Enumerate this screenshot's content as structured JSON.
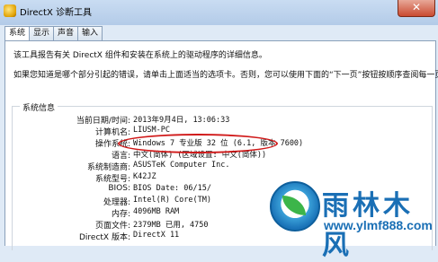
{
  "window": {
    "title": "DirectX 诊断工具",
    "close_symbol": "✕"
  },
  "tabs": [
    {
      "label": "系统",
      "active": true
    },
    {
      "label": "显示",
      "active": false
    },
    {
      "label": "声音",
      "active": false
    },
    {
      "label": "输入",
      "active": false
    }
  ],
  "intro": {
    "line1": "该工具报告有关 DirectX 组件和安装在系统上的驱动程序的详细信息。",
    "line2": "如果您知道是哪个部分引起的错误，请单击上面适当的选项卡。否则，您可以使用下面的“下一页”按钮按顺序查阅每一页。"
  },
  "system_info": {
    "group_title": "系统信息",
    "rows": [
      {
        "label": "当前日期/时间:",
        "value": "2013年9月4日, 13:06:33"
      },
      {
        "label": "计算机名:",
        "value": "LIUSM-PC"
      },
      {
        "label": "操作系统:",
        "value": "Windows 7 专业版 32 位 (6.1, 版本 7600)"
      },
      {
        "label": "语言:",
        "value": "中文(简体) (区域设置: 中文(简体))"
      },
      {
        "label": "系统制造商:",
        "value": "ASUSTeK Computer Inc."
      },
      {
        "label": "系统型号:",
        "value": "K42JZ"
      },
      {
        "label": "BIOS:",
        "value": "BIOS Date: 06/15/"
      },
      {
        "label": "处理器:",
        "value": "Intel(R) Core(TM)"
      },
      {
        "label": "内存:",
        "value": "4096MB RAM"
      },
      {
        "label": "页面文件:",
        "value": "2379MB 已用, 4750"
      },
      {
        "label": "DirectX 版本:",
        "value": "DirectX 11"
      }
    ]
  },
  "watermark": {
    "brand": "雨林木风",
    "url": "www.ylmf888.com"
  },
  "colors": {
    "highlight": "#d01818",
    "brand": "#1a6fb5"
  }
}
